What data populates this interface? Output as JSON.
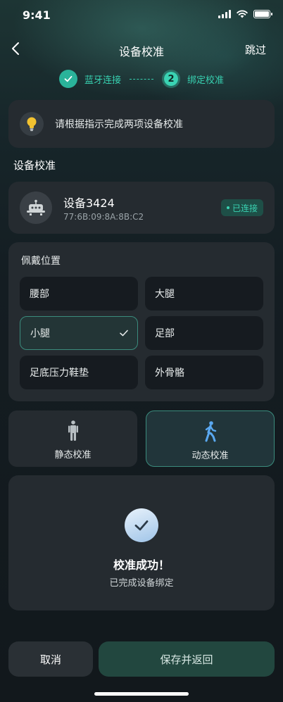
{
  "status_bar": {
    "time": "9:41"
  },
  "nav": {
    "title": "设备校准",
    "skip_label": "跳过"
  },
  "steps": [
    {
      "label": "蓝牙连接",
      "state": "done"
    },
    {
      "number": "2",
      "label": "绑定校准",
      "state": "active"
    }
  ],
  "tip": {
    "text": "请根据指示完成两项设备校准"
  },
  "section_title": "设备校准",
  "device": {
    "name": "设备3424",
    "mac": "77:6B:09:8A:8B:C2",
    "status": "已连接"
  },
  "wear": {
    "title": "佩戴位置",
    "options": [
      "腰部",
      "大腿",
      "小腿",
      "足部",
      "足底压力鞋垫",
      "外骨骼"
    ],
    "selected": "小腿"
  },
  "modes": [
    {
      "label": "静态校准",
      "icon": "standing-person-icon",
      "selected": false
    },
    {
      "label": "动态校准",
      "icon": "walking-person-icon",
      "selected": true
    }
  ],
  "result": {
    "title": "校准成功！",
    "subtitle": "已完成设备绑定"
  },
  "actions": {
    "cancel_label": "取消",
    "save_label": "保存并返回"
  },
  "colors": {
    "accent": "#3ad3b3",
    "selected_border": "#3b8c7d",
    "card": "#252b30",
    "save_button": "#22473f"
  }
}
